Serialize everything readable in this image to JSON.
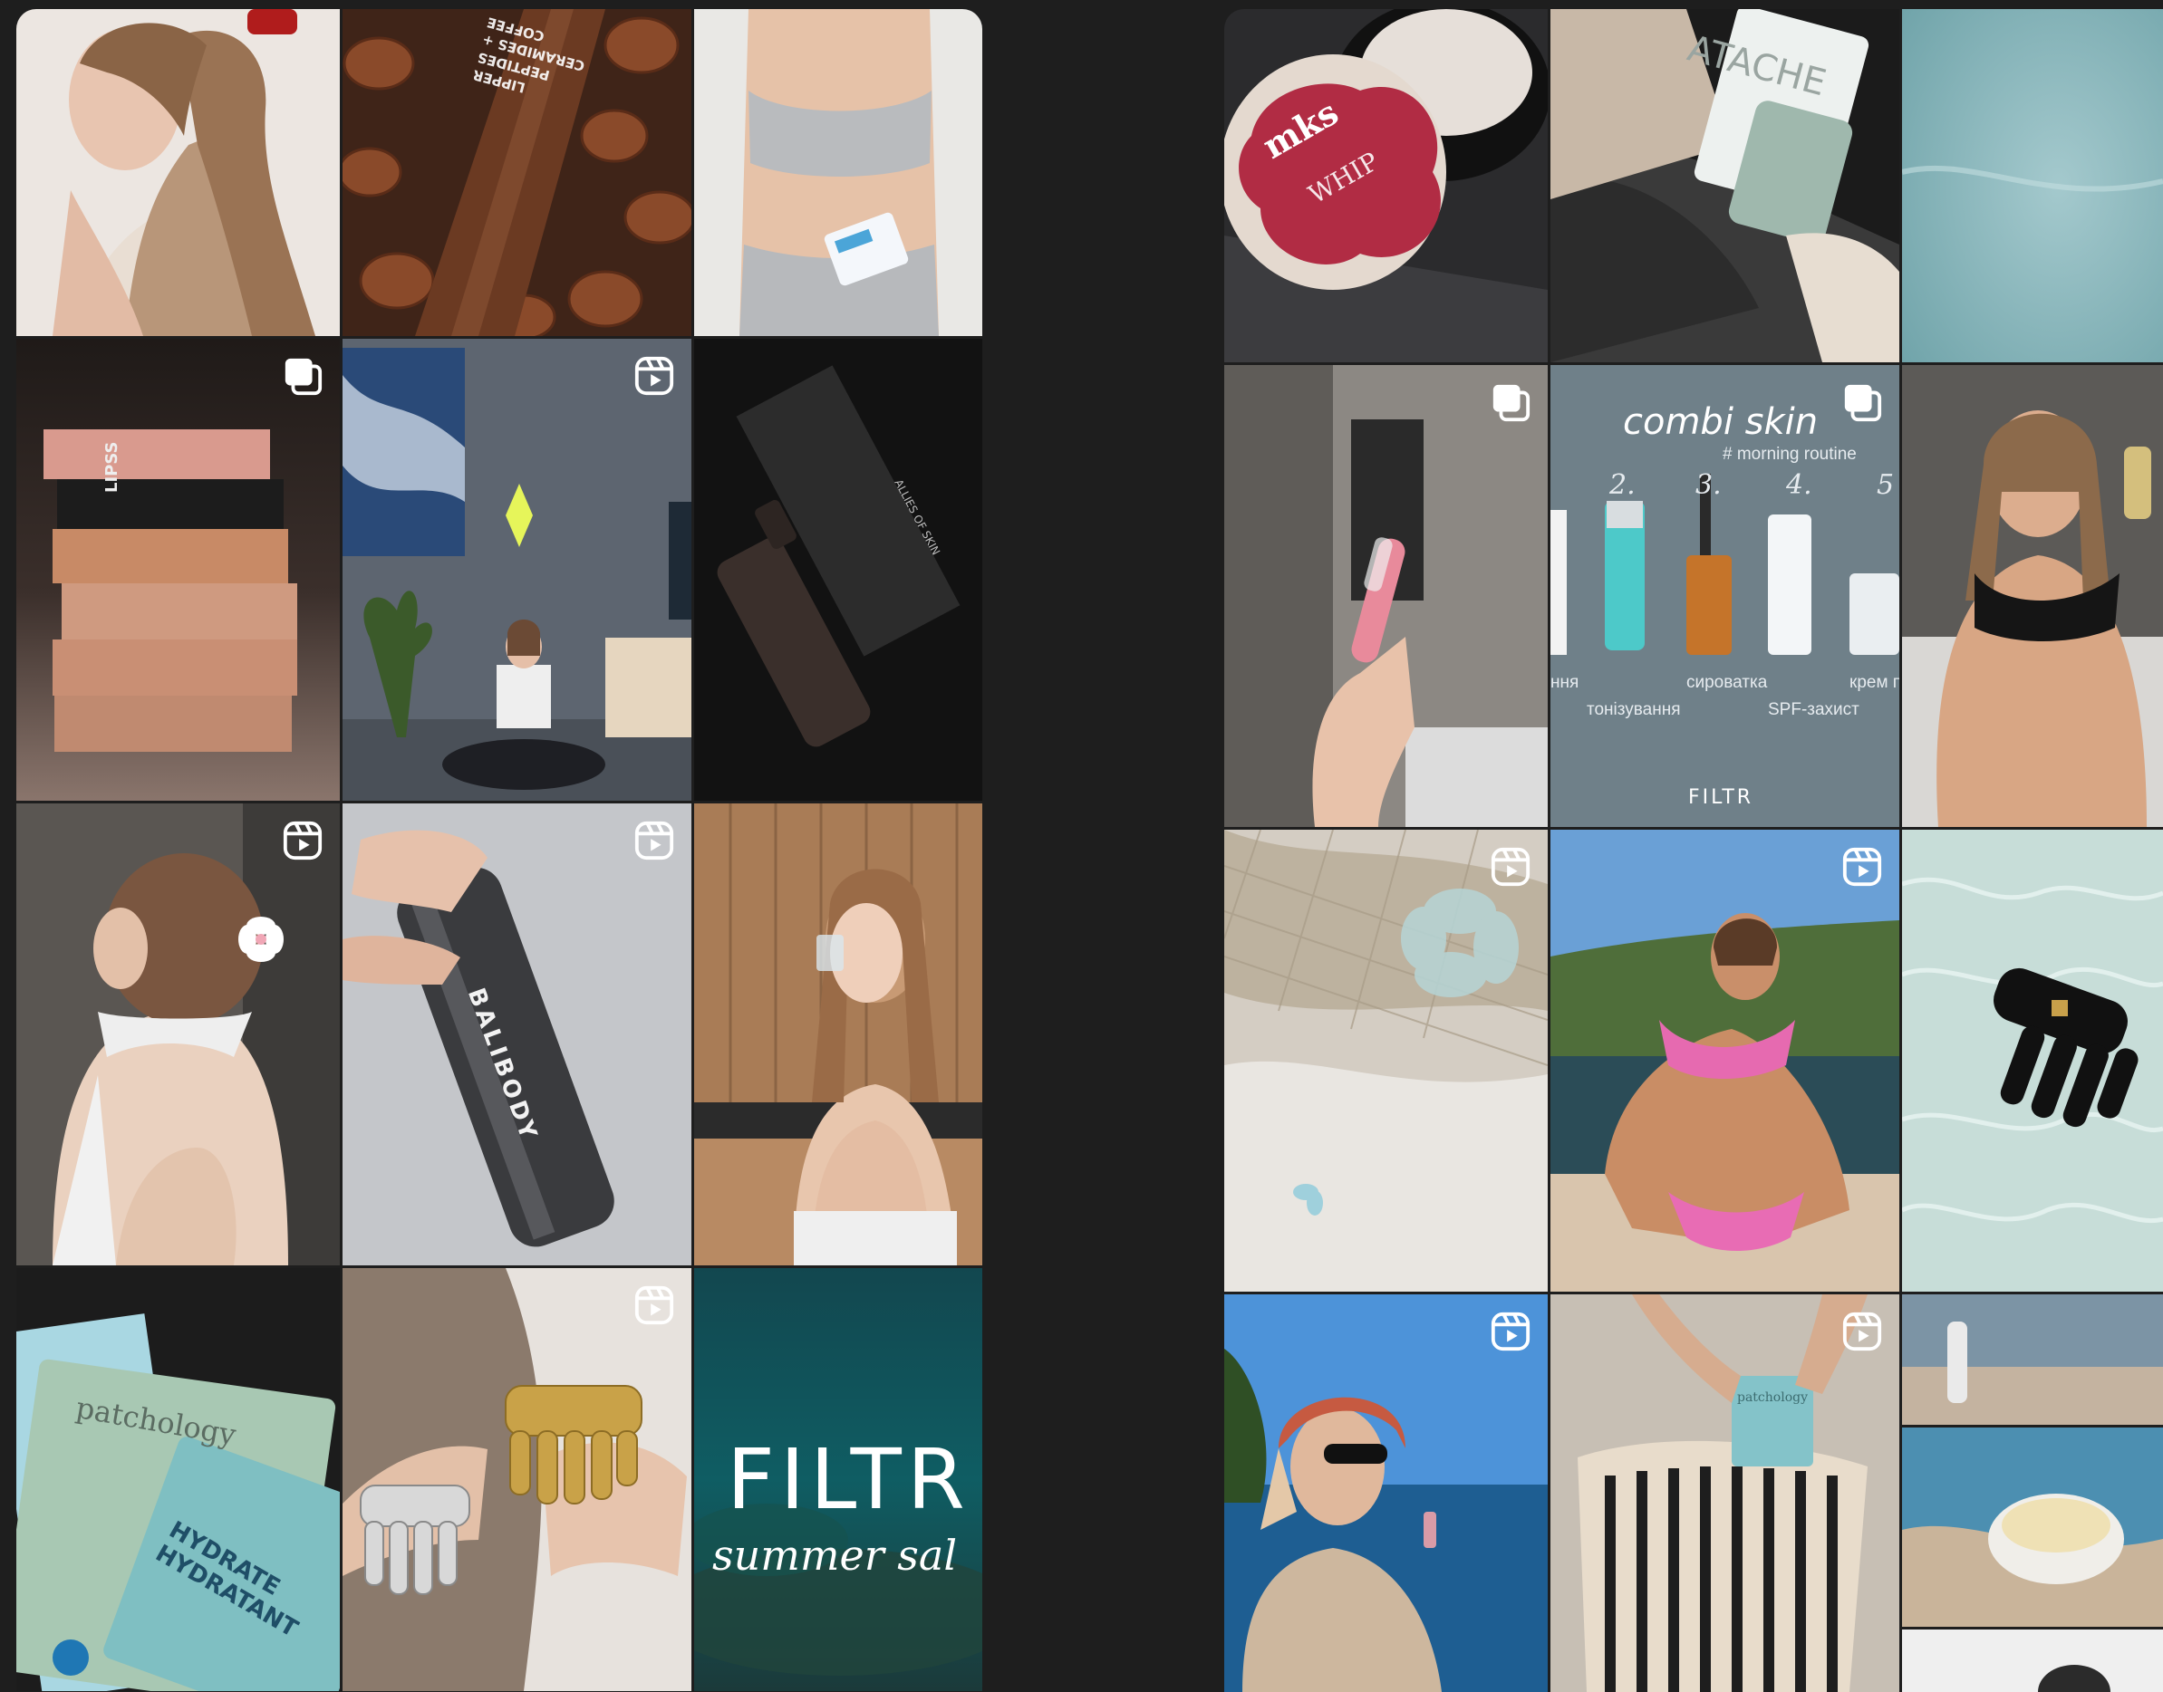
{
  "colors": {
    "background": "#1e1e1e",
    "badge": "#ffffff"
  },
  "feeds": {
    "left": {
      "tiles": [
        {
          "id": "woman-long-hair",
          "badge": "none"
        },
        {
          "id": "coffee-lipper-tube",
          "badge": "none",
          "text": {
            "line1": "COFFEE",
            "line2": "CERAMIDES +",
            "line3": "PEPTIDES",
            "line4": "LIPPER"
          }
        },
        {
          "id": "grey-underwear",
          "badge": "none"
        },
        {
          "id": "lipss-boxes",
          "badge": "carousel-icon",
          "text": {
            "brand": "LIPSS"
          }
        },
        {
          "id": "yoga-room",
          "badge": "reel-icon"
        },
        {
          "id": "allies-of-skin-bottle",
          "badge": "none",
          "text": {
            "brand": "ALLIES OF SKIN"
          }
        },
        {
          "id": "flower-hair-clip",
          "badge": "reel-icon"
        },
        {
          "id": "balibody-can",
          "badge": "reel-icon",
          "text": {
            "brand": "BALIBODY"
          }
        },
        {
          "id": "kitchen-drinking-water",
          "badge": "none"
        },
        {
          "id": "patchology-masks",
          "badge": "none",
          "text": {
            "brand": "patchology",
            "product": "HYDRATE HYDRATANT"
          }
        },
        {
          "id": "hair-claw-clips",
          "badge": "reel-icon"
        },
        {
          "id": "filtr-summer-sale",
          "badge": "none",
          "text": {
            "brand": "FILTR",
            "tagline": "summer sal"
          }
        }
      ]
    },
    "right": {
      "tiles": [
        {
          "id": "mks-whip-butter",
          "badge": "none",
          "text": {
            "brand": "mks",
            "product": "WHIP"
          }
        },
        {
          "id": "cosmetics-bag",
          "badge": "none",
          "text": {
            "brand": "ATACHE"
          }
        },
        {
          "id": "water-surface",
          "badge": "none"
        },
        {
          "id": "ampoule-hand",
          "badge": "carousel-icon"
        },
        {
          "id": "combi-skin-routine",
          "badge": "carousel-icon",
          "text": {
            "title": "combi skin",
            "subtitle": "# morning routine",
            "steps": [
              "2.",
              "3.",
              "4.",
              "5"
            ],
            "labels": [
              "ння",
              "тонізування",
              "сироватка",
              "SPF-захист",
              "крем п"
            ],
            "brand": "FILTR"
          }
        },
        {
          "id": "woman-black-bra",
          "badge": "none"
        },
        {
          "id": "net-bag-flower",
          "badge": "reel-icon"
        },
        {
          "id": "pink-bikini-pool",
          "badge": "reel-icon"
        },
        {
          "id": "black-claw-clip-water",
          "badge": "none"
        },
        {
          "id": "scarf-sunglasses-sea",
          "badge": "reel-icon"
        },
        {
          "id": "striped-beach-bag",
          "badge": "reel-icon",
          "text": {
            "brand": "patchology"
          }
        },
        {
          "id": "beach-collage",
          "badge": "none"
        }
      ]
    }
  }
}
